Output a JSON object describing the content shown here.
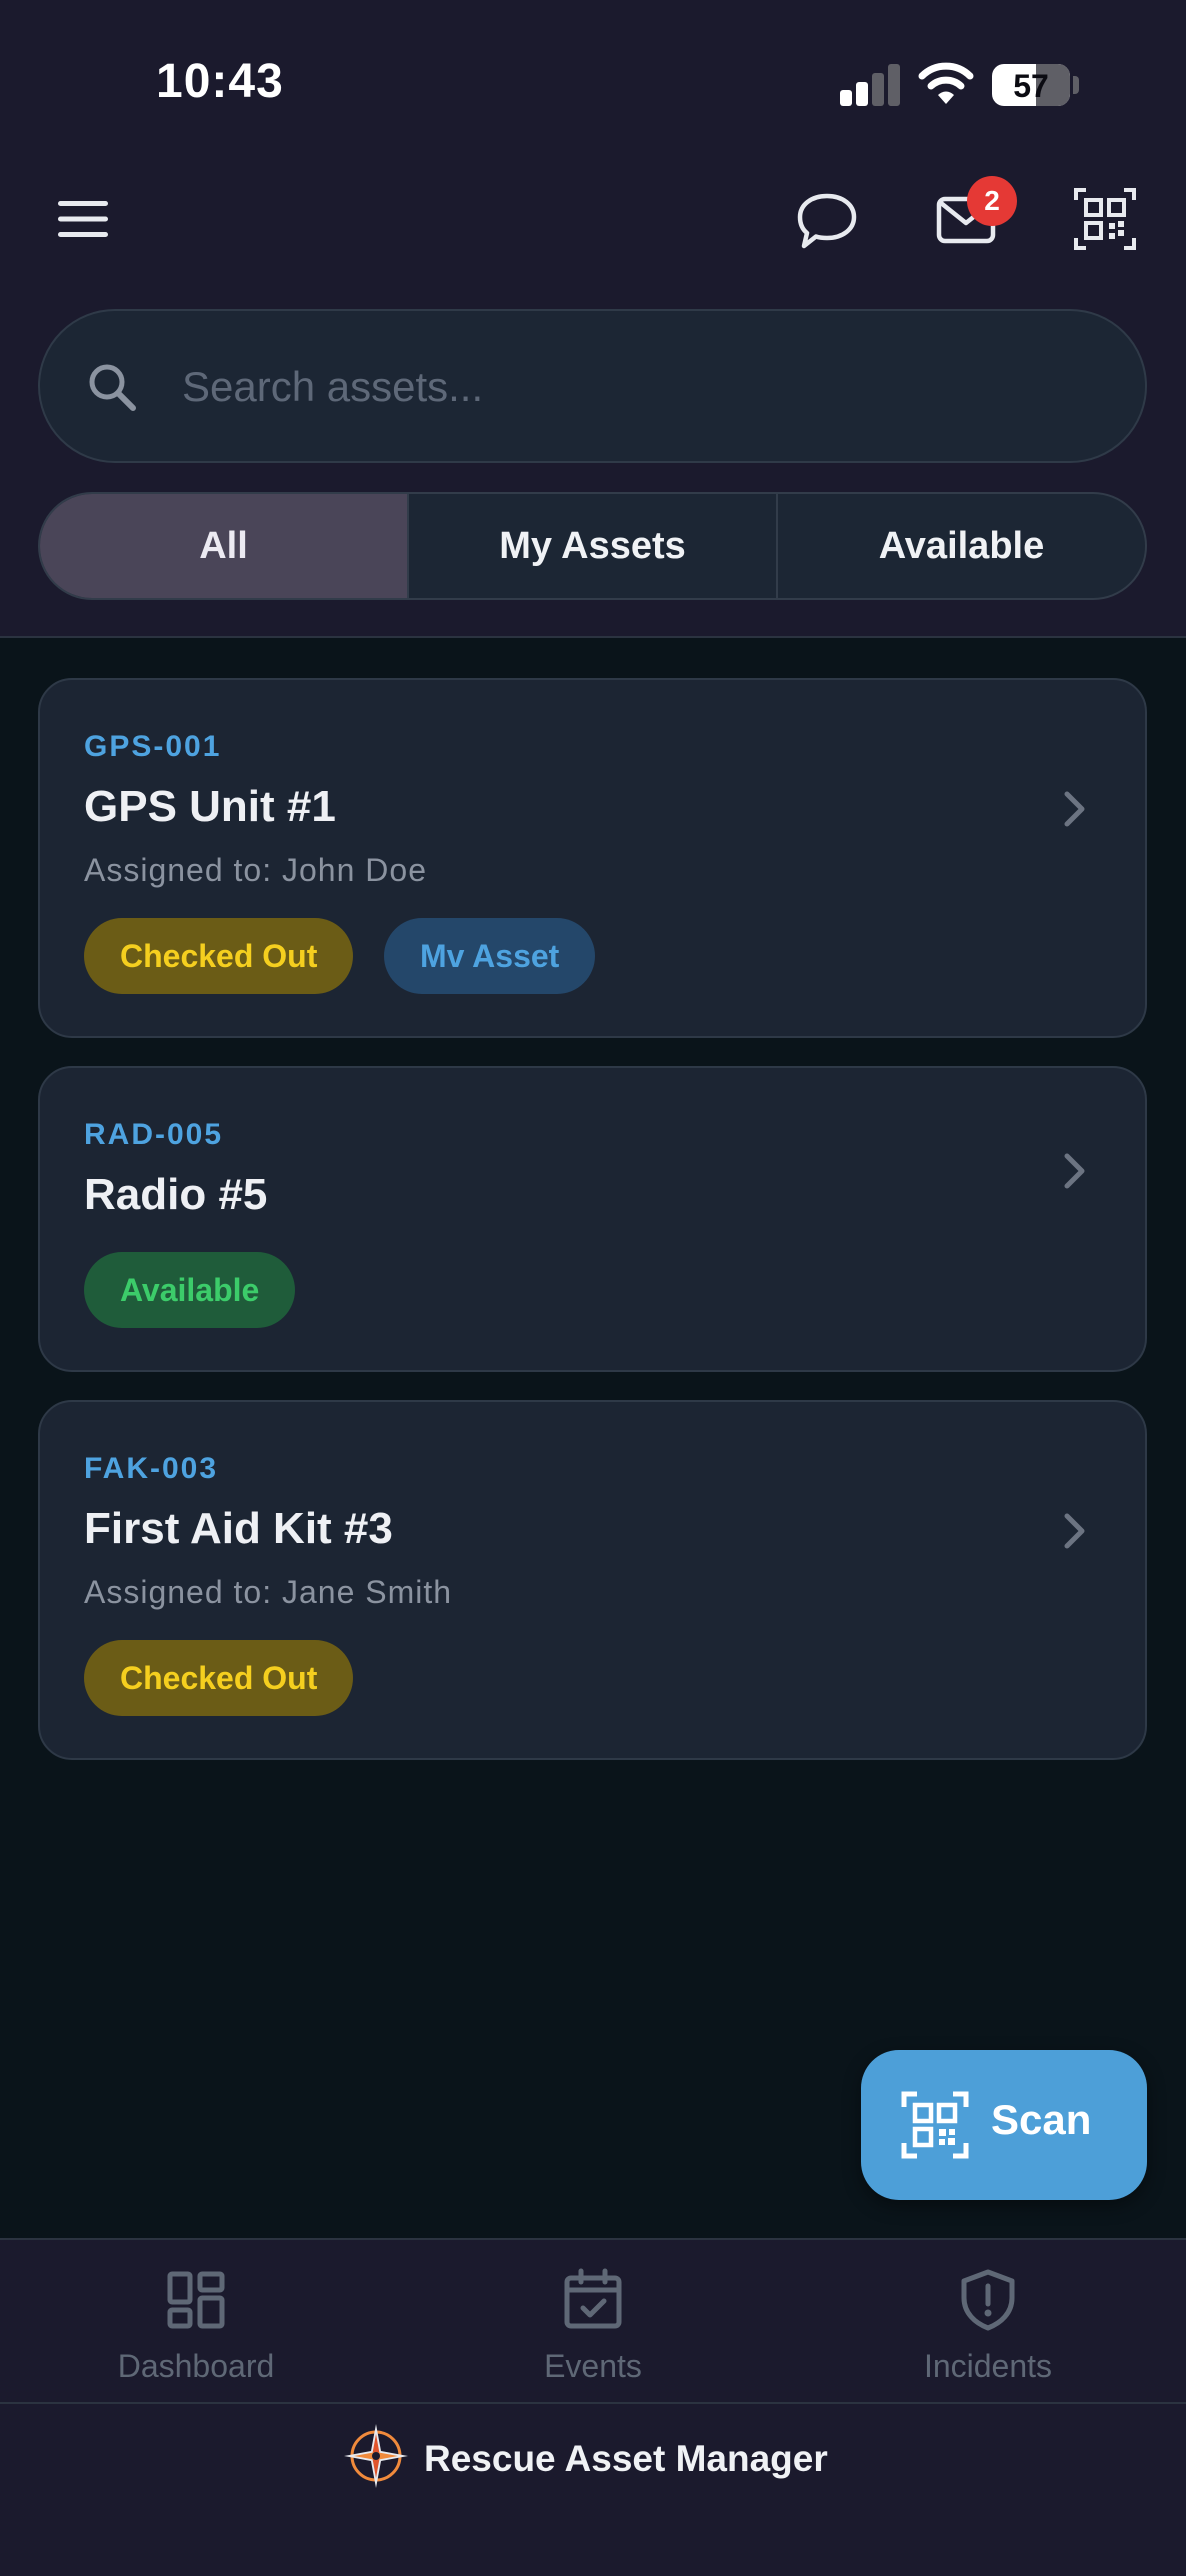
{
  "status_bar": {
    "time": "10:43",
    "battery": "57",
    "battery_level": 0.57
  },
  "header": {
    "menu_icon": "hamburger-menu-icon",
    "chat_icon": "chat-bubble-icon",
    "mail_icon": "mail-icon",
    "mail_badge": "2",
    "qr_icon": "qr-code-icon"
  },
  "search": {
    "placeholder": "Search assets...",
    "value": ""
  },
  "filters": {
    "options": [
      "All",
      "My Assets",
      "Available"
    ],
    "selected": "All"
  },
  "assets": [
    {
      "code": "GPS-001",
      "name": "GPS Unit #1",
      "assigned": "Assigned to: John Doe",
      "tags": [
        "Checked Out",
        "Mv Asset"
      ]
    },
    {
      "code": "RAD-005",
      "name": "Radio #5",
      "assigned": "",
      "tags": [
        "Available"
      ]
    },
    {
      "code": "FAK-003",
      "name": "First Aid Kit #3",
      "assigned": "Assigned to: Jane Smith",
      "tags": [
        "Checked Out"
      ]
    }
  ],
  "scan_button": {
    "label": "Scan",
    "icon": "qr-scan-icon"
  },
  "tabs": [
    {
      "label": "Dashboard",
      "icon": "dashboard-icon"
    },
    {
      "label": "Events",
      "icon": "calendar-icon"
    },
    {
      "label": "Incidents",
      "icon": "shield-alert-icon"
    }
  ],
  "footer": {
    "app_name": "Rescue Asset Manager",
    "logo_icon": "compass-logo-icon"
  },
  "colors": {
    "header_bg": "#1b1a2d",
    "content_bg": "#0a141a",
    "card_bg": "#1c2533",
    "accent_blue": "#4ea3e0",
    "checked_out": "#f5cf1f",
    "available": "#3ccc6a",
    "badge_red": "#e53935"
  }
}
